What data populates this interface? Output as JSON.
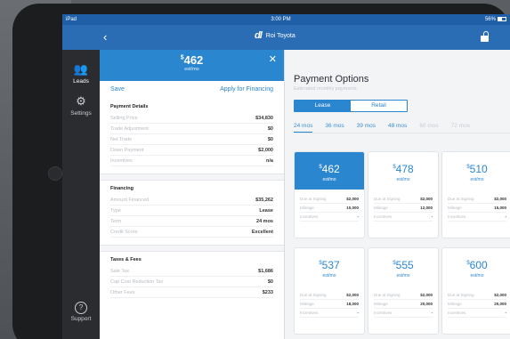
{
  "status": {
    "device": "iPad",
    "time": "3:00 PM",
    "battery": "56%"
  },
  "nav": {
    "back_icon": "‹",
    "brand_logo": "dl",
    "brand_name": "Roi Toyota"
  },
  "rail": {
    "leads": "Leads",
    "settings": "Settings",
    "support": "Support"
  },
  "panel": {
    "amount": "462",
    "currency": "$",
    "per": "est/mo",
    "save": "Save",
    "apply": "Apply for Financing",
    "payment_details": {
      "title": "Payment Details",
      "rows": [
        {
          "label": "Selling Price",
          "value": "$34,830"
        },
        {
          "label": "Trade Adjustment",
          "value": "$0"
        },
        {
          "label": "Net Trade",
          "value": "$0"
        },
        {
          "label": "Down Payment",
          "value": "$2,000"
        },
        {
          "label": "Incentives",
          "value": "n/a"
        }
      ]
    },
    "financing": {
      "title": "Financing",
      "rows": [
        {
          "label": "Amount Financed",
          "value": "$35,262"
        },
        {
          "label": "Type",
          "value": "Lease"
        },
        {
          "label": "Term",
          "value": "24 mos"
        },
        {
          "label": "Credit Score",
          "value": "Excellent"
        }
      ]
    },
    "taxes": {
      "title": "Taxes & Fees",
      "rows": [
        {
          "label": "Sale Tax",
          "value": "$1,686"
        },
        {
          "label": "Cap Cost Reduction Tax",
          "value": "$0"
        },
        {
          "label": "Other Fees",
          "value": "$233"
        }
      ]
    }
  },
  "main": {
    "title": "Payment Options",
    "subtitle": "Estimated monthly payments",
    "seg_lease": "Lease",
    "seg_retail": "Retail",
    "terms": [
      "24 mos",
      "36 mos",
      "39 mos",
      "48 mos",
      "60 mos",
      "72 mos"
    ],
    "cards": [
      {
        "price": "462",
        "est": "est/mo",
        "due_label": "Due at Signing",
        "due": "$2,000",
        "mileage_label": "Mileage",
        "mileage": "10,000",
        "inc_label": "Incentives",
        "inc": "-"
      },
      {
        "price": "478",
        "est": "est/mo",
        "due_label": "Due at Signing",
        "due": "$2,000",
        "mileage_label": "Mileage",
        "mileage": "12,000",
        "inc_label": "Incentives",
        "inc": "-"
      },
      {
        "price": "510",
        "est": "est/mo",
        "due_label": "Due at Signing",
        "due": "$2,000",
        "mileage_label": "Mileage",
        "mileage": "15,000",
        "inc_label": "Incentives",
        "inc": "-"
      },
      {
        "price": "537",
        "est": "est/mo",
        "due_label": "Due at Signing",
        "due": "$2,000",
        "mileage_label": "Mileage",
        "mileage": "18,000",
        "inc_label": "Incentives",
        "inc": "-"
      },
      {
        "price": "555",
        "est": "est/mo",
        "due_label": "Due at Signing",
        "due": "$2,000",
        "mileage_label": "Mileage",
        "mileage": "20,000",
        "inc_label": "Incentives",
        "inc": "-"
      },
      {
        "price": "600",
        "est": "est/mo",
        "due_label": "Due at Signing",
        "due": "$2,000",
        "mileage_label": "Mileage",
        "mileage": "20,000",
        "inc_label": "Incentives",
        "inc": "-"
      }
    ]
  },
  "colors": {
    "accent": "#2b86d0",
    "nav": "#2b6db5",
    "rail": "#2a2c30"
  }
}
